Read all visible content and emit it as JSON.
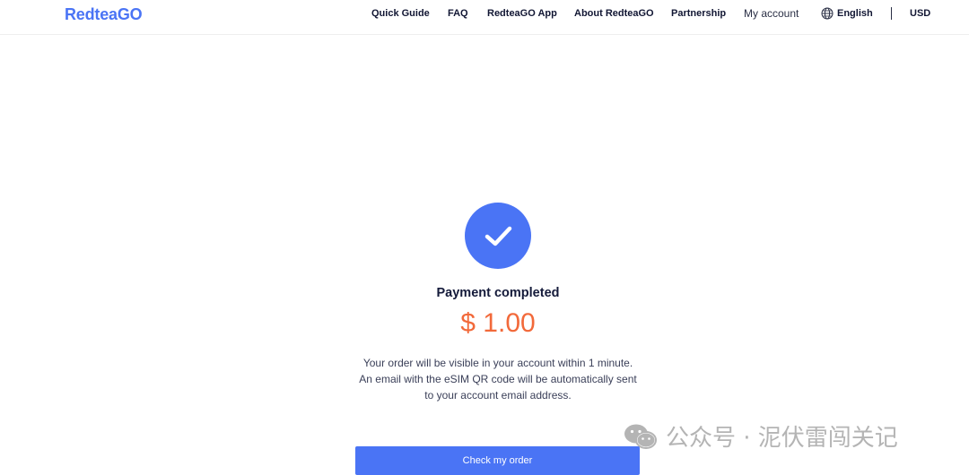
{
  "header": {
    "logo": "RedteaGO",
    "nav": [
      "Quick Guide",
      "FAQ",
      "RedteaGO App",
      "About RedteaGO",
      "Partnership"
    ],
    "account": "My account",
    "language": "English",
    "currency": "USD"
  },
  "main": {
    "status_icon": "check-icon",
    "title": "Payment completed",
    "amount": "$ 1.00",
    "message_lines": [
      "Your order will be visible in your account within 1 minute.",
      "An email with the eSIM QR code will be automatically sent",
      "to your account email address."
    ],
    "button_label": "Check my order"
  },
  "watermark": {
    "text": "公众号 · 泥伏雷闯关记"
  },
  "colors": {
    "accent": "#4a74f5",
    "amount": "#f2693a",
    "text_dark": "#141a3a"
  }
}
